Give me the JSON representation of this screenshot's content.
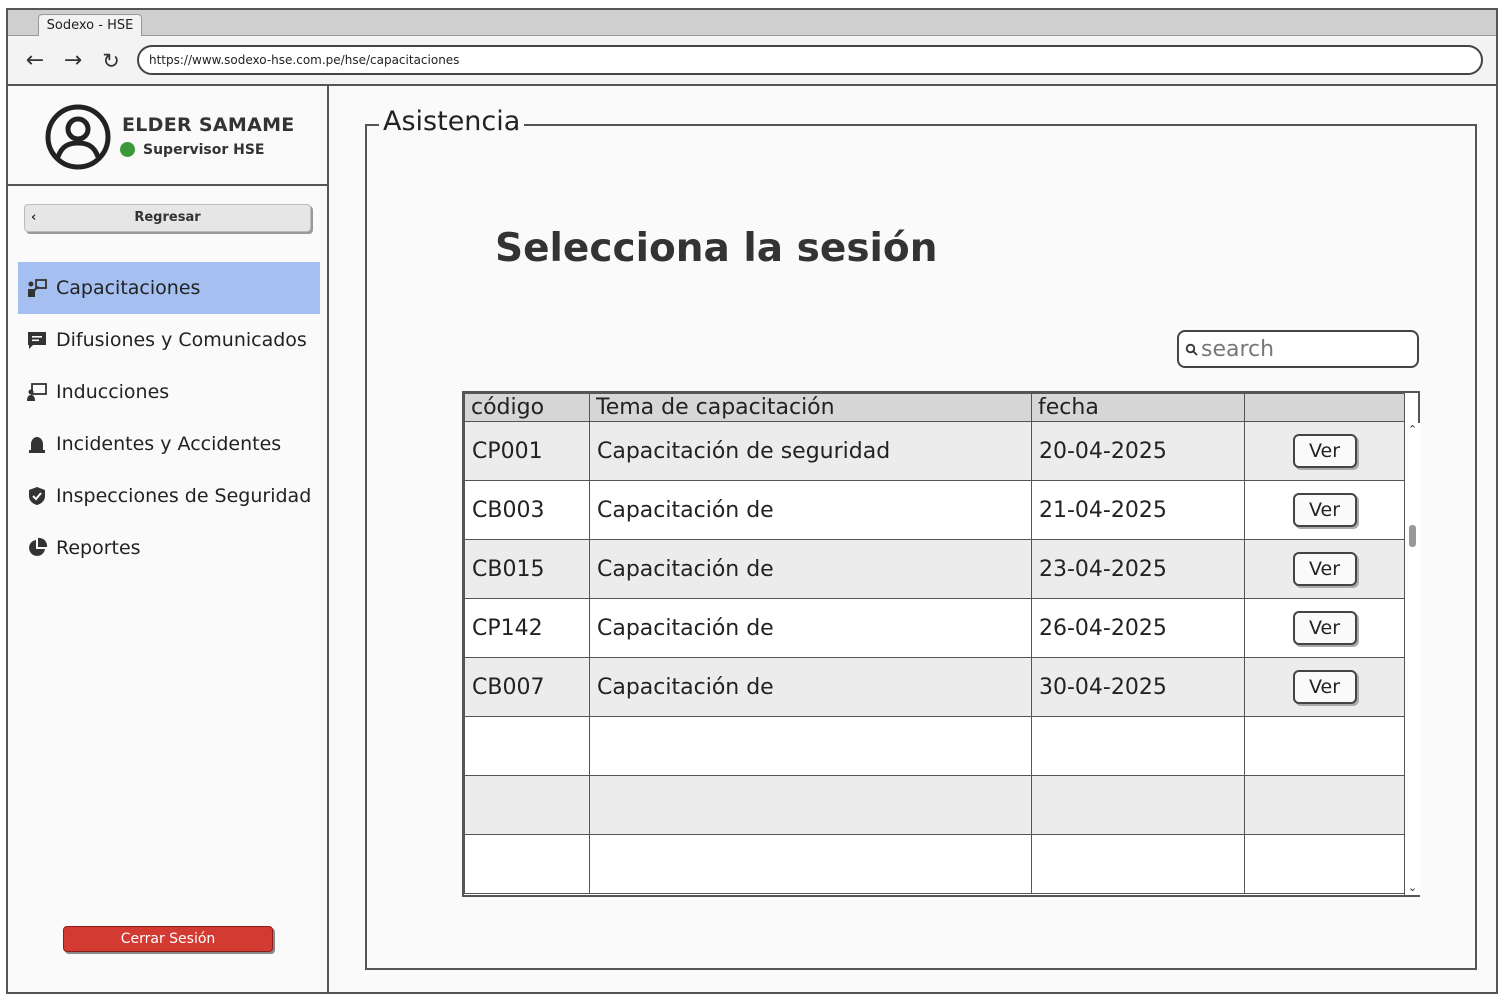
{
  "browser": {
    "tab_title": "Sodexo - HSE",
    "url": "https://www.sodexo-hse.com.pe/hse/capacitaciones"
  },
  "user": {
    "name": "ELDER SAMAME",
    "role": "Supervisor HSE",
    "status_color": "#3a9a3a"
  },
  "sidebar": {
    "back_label": "Regresar",
    "items": [
      {
        "label": "Capacitaciones",
        "icon": "training-icon",
        "active": true
      },
      {
        "label": "Difusiones y Comunicados",
        "icon": "message-icon"
      },
      {
        "label": "Inducciones",
        "icon": "presentation-icon"
      },
      {
        "label": "Incidentes y Accidentes",
        "icon": "alarm-icon"
      },
      {
        "label": "Inspecciones de Seguridad",
        "icon": "shield-check-icon"
      },
      {
        "label": "Reportes",
        "icon": "pie-chart-icon"
      }
    ],
    "logout_label": "Cerrar Sesión",
    "active_color": "#a4bff0",
    "logout_color": "#d33a32"
  },
  "main": {
    "section_label": "Asistencia",
    "title": "Selecciona la sesión",
    "search_placeholder": "search"
  },
  "table": {
    "headers": [
      "código",
      "Tema de capacitación",
      "fecha",
      ""
    ],
    "rows": [
      {
        "codigo": "CP001",
        "tema": "Capacitación de seguridad",
        "fecha": "20-04-2025",
        "action": "Ver"
      },
      {
        "codigo": "CB003",
        "tema": "Capacitación de",
        "fecha": "21-04-2025",
        "action": "Ver"
      },
      {
        "codigo": "CB015",
        "tema": "Capacitación de",
        "fecha": "23-04-2025",
        "action": "Ver"
      },
      {
        "codigo": "CP142",
        "tema": "Capacitación de",
        "fecha": "26-04-2025",
        "action": "Ver"
      },
      {
        "codigo": "CB007",
        "tema": "Capacitación de",
        "fecha": "30-04-2025",
        "action": "Ver"
      }
    ]
  }
}
